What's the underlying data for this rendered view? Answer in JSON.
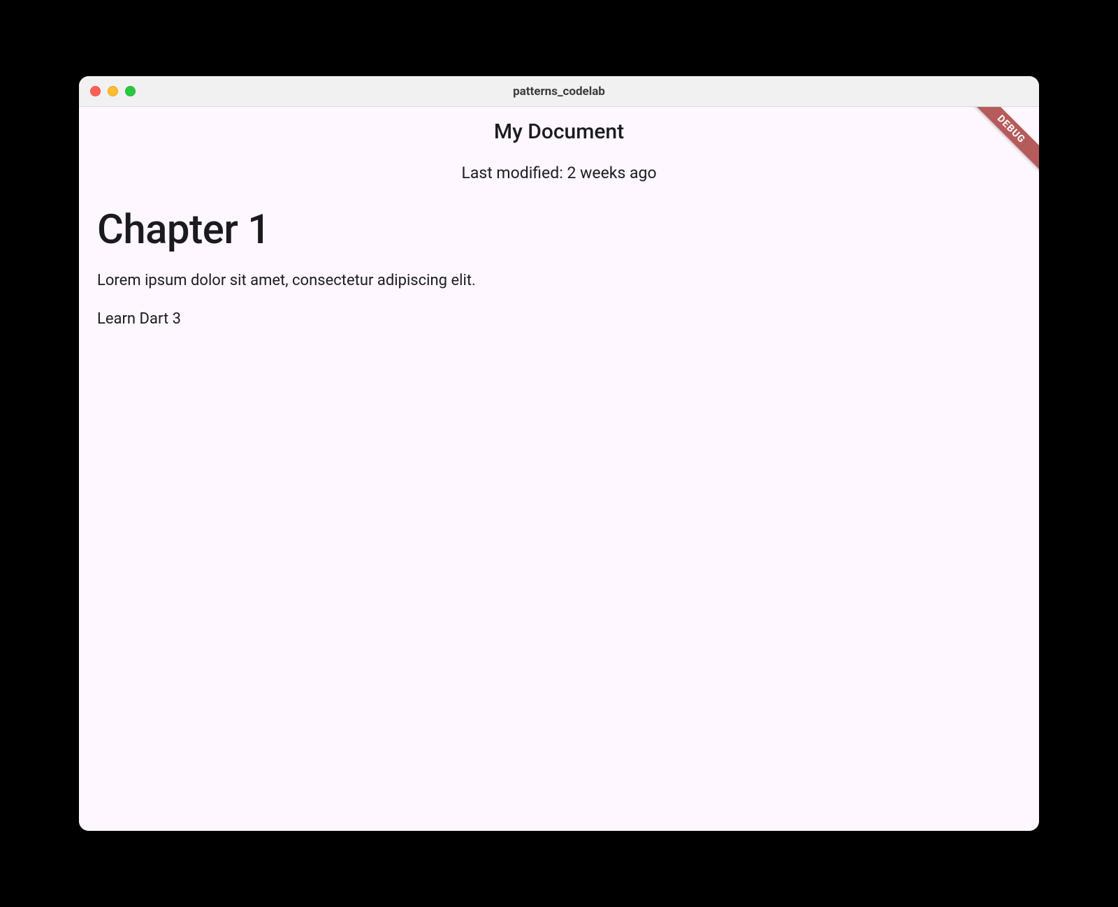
{
  "window": {
    "title": "patterns_codelab"
  },
  "debug_banner": "DEBUG",
  "appbar": {
    "title": "My Document"
  },
  "last_modified": "Last modified: 2 weeks ago",
  "content": {
    "heading": "Chapter 1",
    "paragraph": "Lorem ipsum dolor sit amet, consectetur adipiscing elit.",
    "checkbox_item": "Learn Dart 3"
  }
}
